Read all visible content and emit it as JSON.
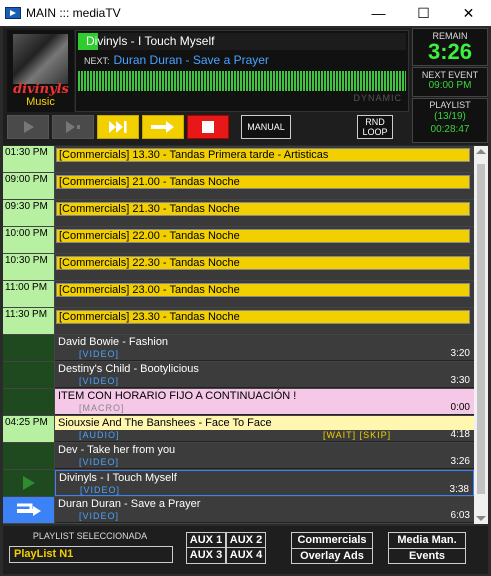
{
  "window": {
    "title": "MAIN ::: mediaTV",
    "min": "—",
    "max": "☐",
    "close": "✕"
  },
  "now": {
    "cover_logo": "divinyls",
    "category": "Music",
    "title": "Divinyls - I Touch Myself",
    "progress_fraction": 0.06,
    "next_label": "NEXT:",
    "next_title": "Duran Duran - Save a Prayer",
    "mode": "DYNAMIC"
  },
  "status": {
    "remain_label": "REMAIN",
    "remain_value": "3:26",
    "next_event_label": "NEXT EVENT",
    "next_event_value": "09:00 PM",
    "playlist_label": "PLAYLIST",
    "playlist_count": "(13/19)",
    "playlist_time": "00:28:47"
  },
  "controls": {
    "manual": "MANUAL",
    "rnd_line1": "RND",
    "rnd_line2": "LOOP"
  },
  "commercials": [
    {
      "time": "01:30 PM",
      "text": "[Commercials] 13.30 - Tandas Primera tarde - Artisticas"
    },
    {
      "time": "09:00 PM",
      "text": "[Commercials] 21.00 - Tandas Noche"
    },
    {
      "time": "09:30 PM",
      "text": "[Commercials] 21.30 - Tandas Noche"
    },
    {
      "time": "10:00 PM",
      "text": "[Commercials] 22.00 - Tandas Noche"
    },
    {
      "time": "10:30 PM",
      "text": "[Commercials] 22.30 - Tandas Noche"
    },
    {
      "time": "11:00 PM",
      "text": "[Commercials] 23.00 - Tandas Noche"
    },
    {
      "time": "11:30 PM",
      "text": "[Commercials] 23.30 - Tandas Noche"
    }
  ],
  "items": [
    {
      "title": "David Bowie - Fashion",
      "type": "[VIDEO]",
      "dur": "3:20"
    },
    {
      "title": "Destiny's Child - Bootylicious",
      "type": "[VIDEO]",
      "dur": "3:30"
    }
  ],
  "macro": {
    "title": "ITEM CON HORARIO FIJO A CONTINUACIÓN !",
    "type": "[MACRO]",
    "dur": "0:00"
  },
  "fixed": {
    "time": "04:25 PM",
    "title": "Siouxsie And The Banshees - Face To Face",
    "type": "[AUDIO]",
    "flags": "[WAIT] [SKIP]",
    "dur": "4:18"
  },
  "after": [
    {
      "title": "Dev - Take her from you",
      "type": "[VIDEO]",
      "dur": "3:26"
    }
  ],
  "playing": {
    "title": "Divinyls - I Touch Myself",
    "type": "[VIDEO]",
    "dur": "3:38"
  },
  "next_item": {
    "title": "Duran Duran - Save a Prayer",
    "type": "[VIDEO]",
    "dur": "6:03"
  },
  "footer": {
    "playlist_sel_label": "PLAYLIST SELECCIONADA",
    "playlist_name": "PlayList N1",
    "aux1": "AUX 1",
    "aux2": "AUX 2",
    "aux3": "AUX 3",
    "aux4": "AUX 4",
    "commercials": "Commercials",
    "overlay": "Overlay Ads",
    "mediaman": "Media Man.",
    "events": "Events"
  }
}
